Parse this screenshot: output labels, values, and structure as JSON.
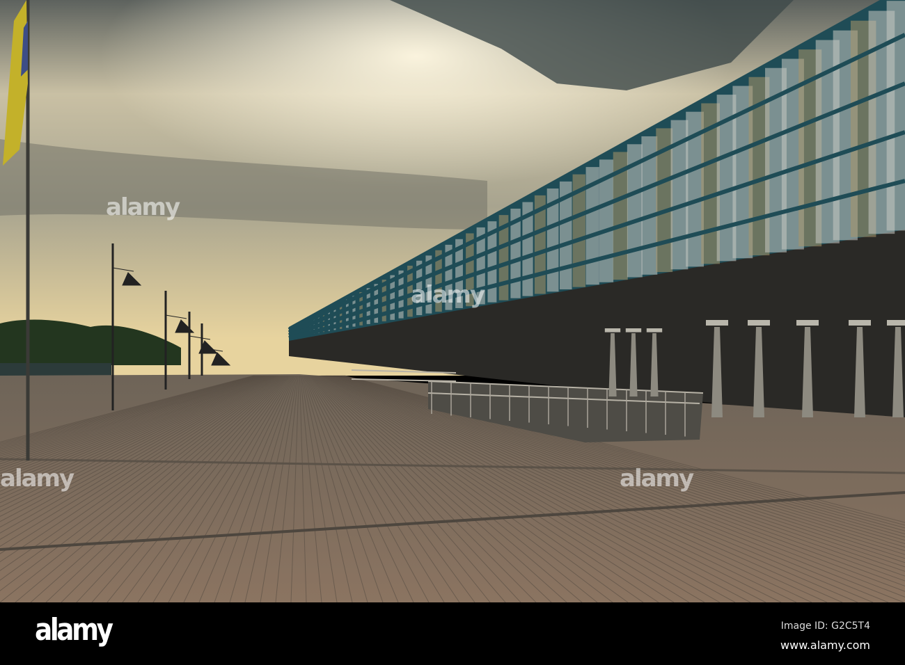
{
  "photo": {
    "watermark": "alamy",
    "colors": {
      "sky_light": "#f4ecd2",
      "sky_dark": "#4f5656",
      "building": "#1f4c56",
      "wood": "#8a7663",
      "water": "#2c3b3a"
    }
  },
  "footer": {
    "logo": "alamy",
    "image_id": "Image ID: G2C5T4",
    "website": "www.alamy.com"
  }
}
